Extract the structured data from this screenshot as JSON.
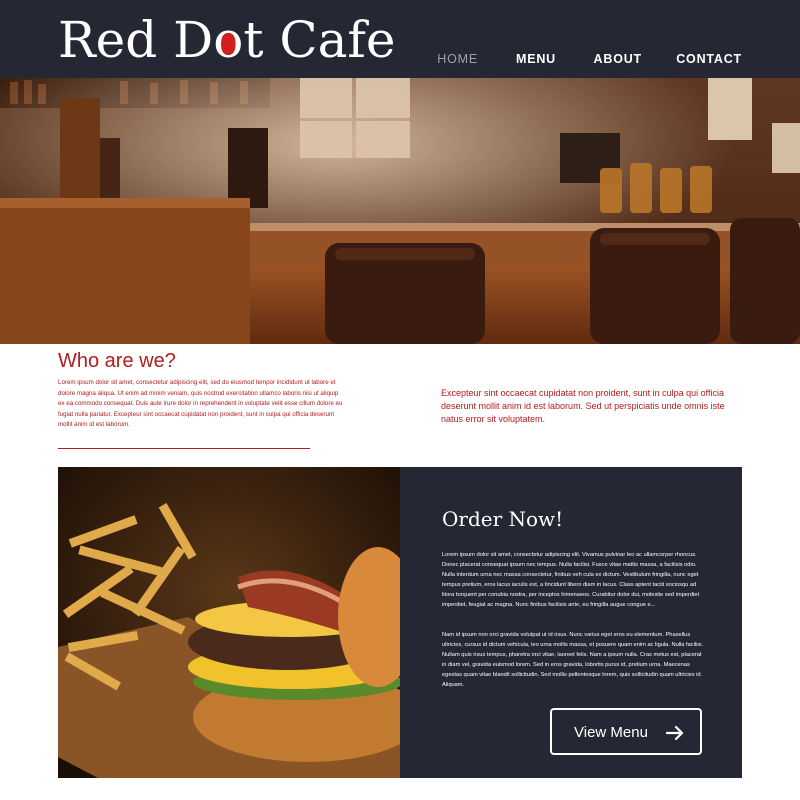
{
  "site": {
    "logo_before": "Red D",
    "logo_o": "o",
    "logo_after": "t Cafe",
    "brand_red": "#d21f1f",
    "header_bg": "#252834"
  },
  "nav": {
    "items": [
      {
        "label": "HOME",
        "active": true
      },
      {
        "label": "MENU",
        "active": false
      },
      {
        "label": "ABOUT",
        "active": false
      },
      {
        "label": "CONTACT",
        "active": false
      }
    ]
  },
  "about": {
    "title": "Who are we?",
    "body": "Lorem ipsum dolor sit amet, consectetur adipiscing elit, sed do eiusmod tempor incididunt ut labore et dolore magna aliqua. Ut enim ad minim veniam, quis nostrud exercitation ullamco laboris nisi ut aliquip ex ea commodo consequat. Duis aute irure dolor in reprehenderit in voluptate velit esse cillum dolore eu fugiat nulla pariatur. Excepteur sint occaecat cupidatat non proident, sunt in culpa qui officia deserunt mollit anim id est laborum.",
    "quote": "Excepteur sint occaecat cupidatat non proident, sunt in culpa qui officia deserunt mollit anim id est laborum. Sed ut perspiciatis unde omnis iste natus error sit voluptatem."
  },
  "order": {
    "title": "Order Now!",
    "para1": "Lorem ipsum dolor sit amet, consectetur adipiscing elit. Vivamus pulvinar leo ac ullamcorper rhoncus. Donec placerat consequat ipsum nec tempus. Nulla facilisi. Fusce vitae mattis massa, a facilisis odio. Nulla interdum urna nec massa consectetur, finibus veh cula ex dictum. Vestibulum fringilla, nunc eget tempus pretium, eros lacus iaculis est, a tincidunt libero diam in lacus. Class aptent taciti sociosqu ad litora torquent per conubia nostra, per inceptos himenaeos. Curabitur dolor dui, molestie sed imperdiet imperdiet, feugiat ac magna. Nunc finibus facilisis ante, eu fringilla augue congue e...",
    "para2": "Nam id ipsum non orci gravida volutpat ut id risus. Nunc varius eget eros eu elementum. Phasellus ultricies, cursus id dictum vehicula, leo urna mollis massa, et posuere quam enim ac ligula. Nulla facilisi. Nullam quis risus tempus, pharetra orci vitae, laoreet felis. Nam a ipsum nulla. Cras metus est, placerat in diam vel, gravida euismod lorem. Sed in eros gravida, lobortis purus id, pretium urna. Maecenas egestas quam vitae blandit sollicitudin. Sed mollis pellentesque lorem, quis sollicitudin quam ultricies id. Aliquam.",
    "button": "View Menu"
  }
}
